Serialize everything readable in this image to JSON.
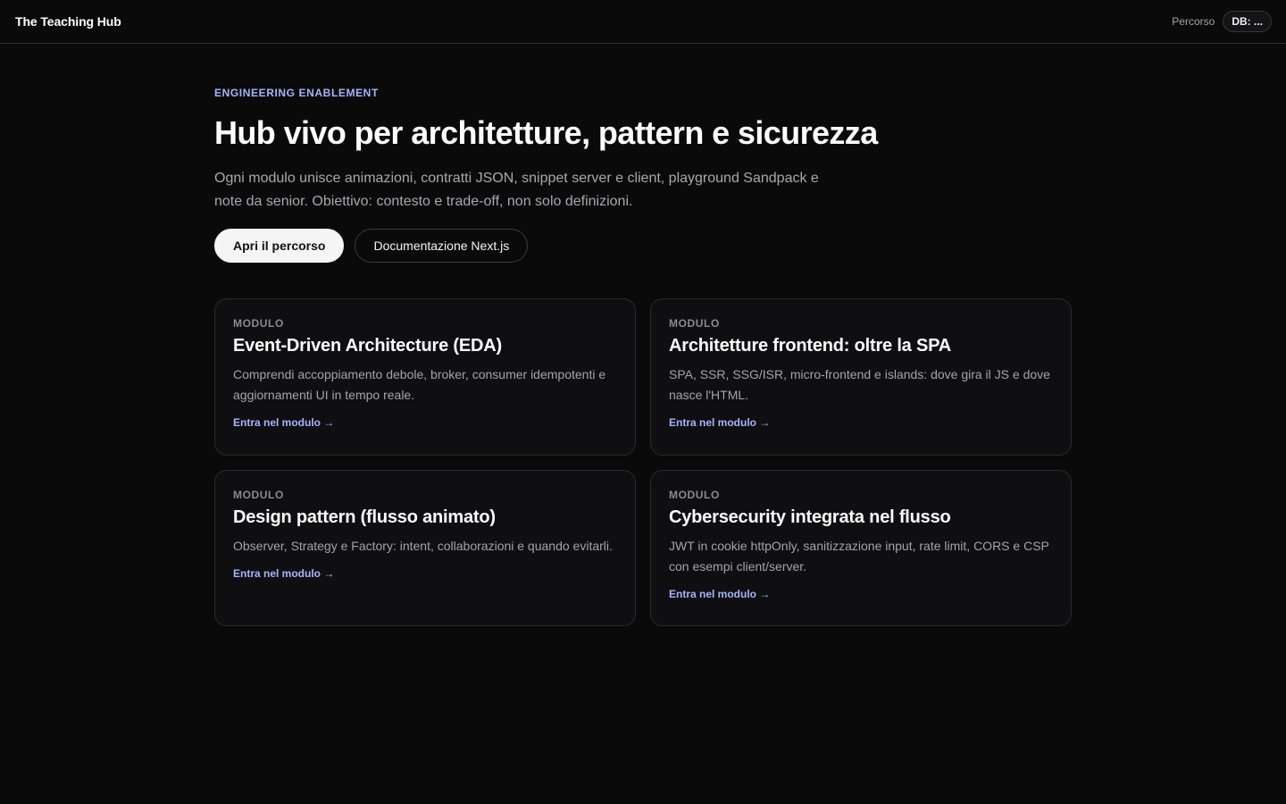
{
  "header": {
    "brand": "The Teaching Hub",
    "nav_link": "Percorso",
    "db_status": "DB: ..."
  },
  "hero": {
    "eyebrow": "ENGINEERING ENABLEMENT",
    "title": "Hub vivo per architetture, pattern e sicurezza",
    "description": "Ogni modulo unisce animazioni, contratti JSON, snippet server e client, playground Sandpack e note da senior. Obiettivo: contesto e trade-off, non solo definizioni.",
    "primary_button": "Apri il percorso",
    "secondary_button": "Documentazione Next.js"
  },
  "modules": [
    {
      "eyebrow": "MODULO",
      "title": "Event-Driven Architecture (EDA)",
      "description": "Comprendi accoppiamento debole, broker, consumer idempotenti e aggiornamenti UI in tempo reale.",
      "link": "Entra nel modulo →"
    },
    {
      "eyebrow": "MODULO",
      "title": "Architetture frontend: oltre la SPA",
      "description": "SPA, SSR, SSG/ISR, micro-frontend e islands: dove gira il JS e dove nasce l'HTML.",
      "link": "Entra nel modulo →"
    },
    {
      "eyebrow": "MODULO",
      "title": "Design pattern (flusso animato)",
      "description": "Observer, Strategy e Factory: intent, collaborazioni e quando evitarli.",
      "link": "Entra nel modulo →"
    },
    {
      "eyebrow": "MODULO",
      "title": "Cybersecurity integrata nel flusso",
      "description": "JWT in cookie httpOnly, sanitizzazione input, rate limit, CORS e CSP con esempi client/server.",
      "link": "Entra nel modulo →"
    }
  ],
  "colors": {
    "background": "#0a0a0b",
    "accent": "#a5b4fc",
    "card_border": "#2a2a2f"
  }
}
